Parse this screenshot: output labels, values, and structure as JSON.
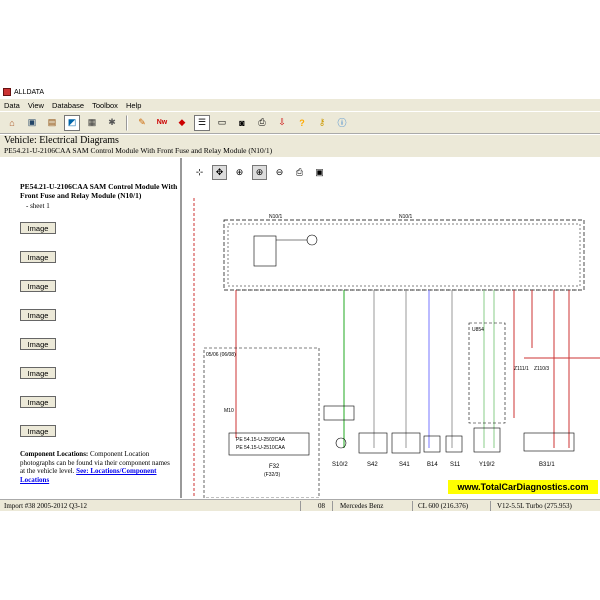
{
  "window": {
    "title": "ALLDATA"
  },
  "menu": [
    "Data",
    "View",
    "Database",
    "Toolbox",
    "Help"
  ],
  "vehicle_bar": {
    "heading": "Vehicle:  Electrical Diagrams",
    "subtitle": "PE54.21-U-2106CAA SAM Control Module With Front Fuse and Relay Module (N10/1)"
  },
  "left_pane": {
    "procedure_title": "PE54.21-U-2106CAA SAM Control Module With Front Fuse and Relay Module (N10/1)",
    "sheet": "- sheet 1",
    "image_buttons": [
      "Image",
      "Image",
      "Image",
      "Image",
      "Image",
      "Image",
      "Image",
      "Image"
    ],
    "component_locations_label": "Component Locations:",
    "component_locations_text": " Component Location photographs can be found via their component names at the vehicle level. ",
    "component_locations_link": "See: Locations/Component Locations"
  },
  "diagram": {
    "module_label": "N10/1",
    "fuse_label": "F32",
    "fuse_ref": "(F32/3)",
    "ref_box": "05/06\n(06/08)",
    "conn_m10": "M10",
    "pe_ref_1": "PE 54.15-U-2502CAA",
    "pe_ref_2": "PE 54.15-U-2510CAA",
    "bottom_labels": [
      "S10/2",
      "S42",
      "S41",
      "B14",
      "S11",
      "Y19/2",
      "Z111/1",
      "Z110/3",
      "B31/1"
    ],
    "side_labels": [
      "U854",
      "Z110/1",
      "Z110/3",
      "Z111/1"
    ]
  },
  "watermark": "www.TotalCarDiagnostics.com",
  "status": {
    "import": "Import #38 2005-2012 Q3-12",
    "year": "08",
    "make": "Mercedes Benz",
    "model": "CL 600 (216.376)",
    "engine": "V12-5.5L Turbo (275.953)"
  }
}
